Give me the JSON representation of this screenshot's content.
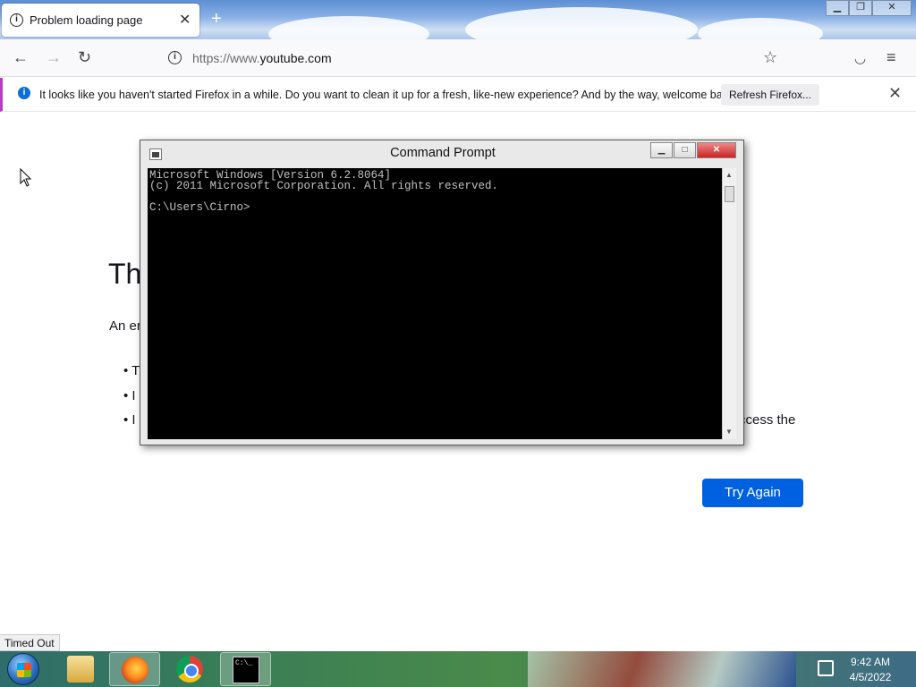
{
  "browser": {
    "tab_title": "Problem loading page",
    "url_prefix": "https://www.",
    "url_domain": "youtube.com"
  },
  "notification": {
    "message": "It looks like you haven't started Firefox in a while. Do you want to clean it up for a fresh, like-new experience? And by the way, welcome back!",
    "button_label": "Refresh Firefox..."
  },
  "page": {
    "heading_visible": "Th",
    "description_visible": "An er",
    "bullets_visible": [
      "T",
      "I",
      "I"
    ],
    "bullet_overflow_text": "ccess the",
    "try_again_label": "Try Again"
  },
  "status_bar": {
    "text": "Timed Out"
  },
  "cmd_window": {
    "title": "Command Prompt",
    "console_lines": [
      "Microsoft Windows [Version 6.2.8064]",
      "(c) 2011 Microsoft Corporation. All rights reserved.",
      "",
      "C:\\Users\\Cirno>"
    ]
  },
  "taskbar": {
    "apps": [
      "start-menu",
      "file-explorer",
      "firefox",
      "chrome",
      "command-prompt"
    ],
    "active_app": "firefox",
    "cmd_icon_text": "C:\\_",
    "time": "9:42 AM",
    "date": "4/5/2022"
  },
  "colors": {
    "accent_blue": "#0061e0",
    "notification_info": "#0b6fd6",
    "notification_border": "#b83cc4",
    "console_bg": "#000000",
    "console_fg": "#c0c0c0"
  }
}
